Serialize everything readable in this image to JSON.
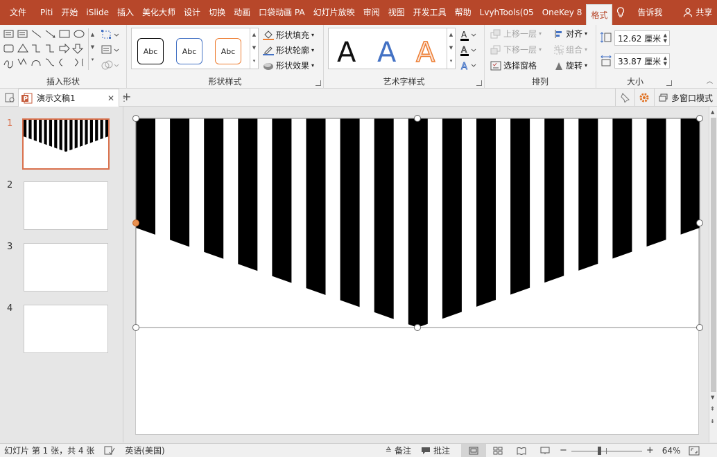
{
  "ribbon_tabs": {
    "file": "文件",
    "items": [
      "Piti",
      "开始",
      "iSlide",
      "插入",
      "美化大师",
      "设计",
      "切换",
      "动画",
      "口袋动画 PA",
      "幻灯片放映",
      "审阅",
      "视图",
      "开发工具",
      "帮助",
      "LvyhTools(05",
      "OneKey 8"
    ],
    "active": "格式",
    "tell_me": "告诉我",
    "share": "共享"
  },
  "ribbon": {
    "insert_shapes_label": "插入形状",
    "shape_styles_label": "形状样式",
    "abc": "Abc",
    "shape_fill": "形状填充",
    "shape_outline": "形状轮廓",
    "shape_effects": "形状效果",
    "wordart_label": "艺术字样式",
    "wordart_letter": "A",
    "bring_forward": "上移一层",
    "send_backward": "下移一层",
    "selection_pane": "选择窗格",
    "align": "对齐",
    "group": "组合",
    "rotate": "旋转",
    "arrange_label": "排列",
    "height_value": "12.62 厘米",
    "width_value": "33.87 厘米",
    "size_label": "大小"
  },
  "doc": {
    "tab_title": "演示文稿1",
    "multi_window": "多窗口模式"
  },
  "thumbnails": [
    "1",
    "2",
    "3",
    "4"
  ],
  "status": {
    "slide_info": "幻灯片 第 1 张，共 4 张",
    "language": "英语(美国)",
    "notes": "备注",
    "comments": "批注",
    "zoom": "64%"
  },
  "colors": {
    "accent": "#b7472a",
    "selection_thumb": "#d9704c",
    "wordart_blue": "#4472c4",
    "wordart_orange": "#ed7d31"
  }
}
